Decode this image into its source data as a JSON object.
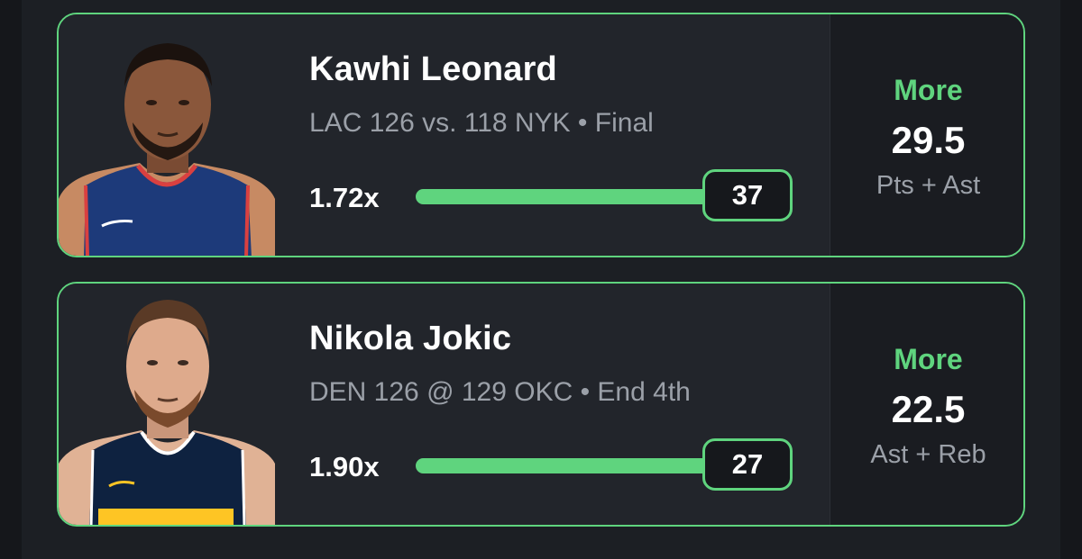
{
  "colors": {
    "accent": "#5fd47e",
    "card_bg": "#22252b",
    "text_primary": "#ffffff",
    "text_secondary": "#9ba0a8"
  },
  "cards": [
    {
      "player_name": "Kawhi Leonard",
      "game_info": "LAC 126 vs. 118 NYK • Final",
      "multiplier": "1.72x",
      "stat_value": "37",
      "progress": 1.0,
      "pick_direction": "More",
      "pick_line": "29.5",
      "pick_stat": "Pts + Ast",
      "jersey_color": "#1d3a7a",
      "photo_icon": "player-headshot-icon"
    },
    {
      "player_name": "Nikola Jokic",
      "game_info": "DEN 126 @ 129 OKC • End 4th",
      "multiplier": "1.90x",
      "stat_value": "27",
      "progress": 1.0,
      "pick_direction": "More",
      "pick_line": "22.5",
      "pick_stat": "Ast + Reb",
      "jersey_color": "#0e2240",
      "photo_icon": "player-headshot-icon"
    }
  ]
}
